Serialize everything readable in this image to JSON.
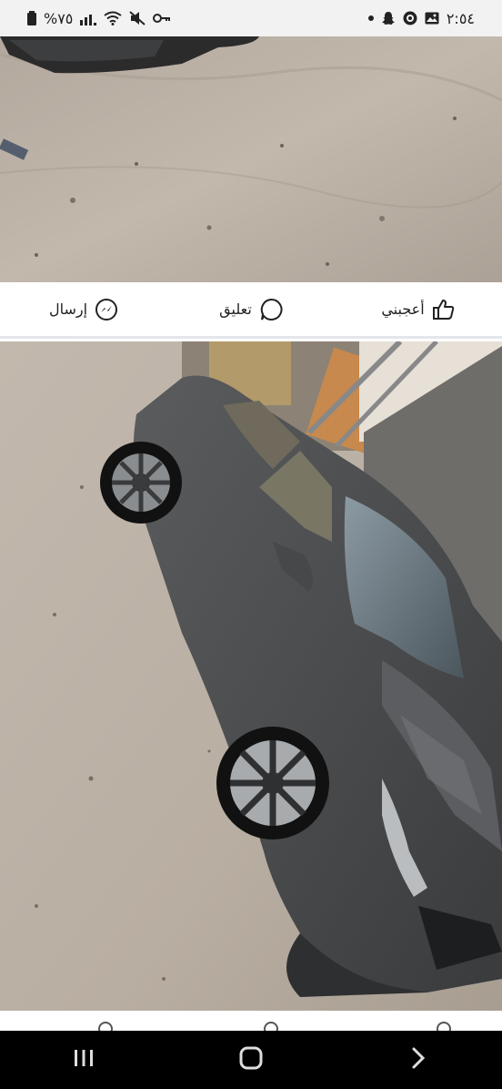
{
  "status_bar": {
    "time": "٢:٥٤",
    "battery": "%٧٥"
  },
  "post_actions": {
    "like_label": "أعجبني",
    "comment_label": "تعليق",
    "send_label": "إرسال"
  },
  "colors": {
    "statusbar_bg": "#f2f2f2",
    "navbar_bg": "#000000",
    "divider": "#e4e6eb",
    "icon": "#222222"
  }
}
